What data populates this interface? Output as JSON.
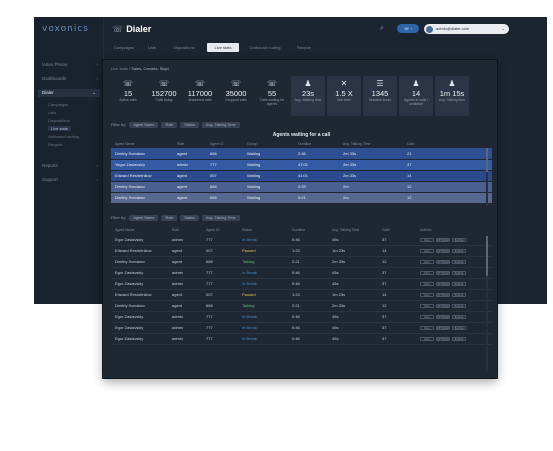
{
  "brand": "voxonics",
  "sidebar": {
    "items": [
      {
        "label": "Votes Phone",
        "arrow": "›"
      },
      {
        "label": "Dashboards",
        "arrow": "›"
      },
      {
        "label": "Dialer",
        "arrow": "⌄"
      }
    ],
    "sub_items": [
      "Campaigns",
      "Lists",
      "Dispositions",
      "Live stats",
      "Outbound routing",
      "Recycle"
    ],
    "bottom_items": [
      {
        "label": "Reports",
        "arrow": "›"
      },
      {
        "label": "Support",
        "arrow": "›"
      }
    ]
  },
  "header": {
    "title": "Dialer",
    "notif_label": "☏ ",
    "account_label": "admin@dialer.com"
  },
  "tabs": [
    "Campaigns",
    "Lists",
    "Dispositions",
    "Live stats",
    "Outbound routing",
    "Recycle"
  ],
  "breadcrumb": {
    "prefix": "Live stats /",
    "current": "Sales, Canada, Skyd"
  },
  "stats": [
    {
      "icon": "☏",
      "value": "15",
      "label": "Active calls"
    },
    {
      "icon": "☏",
      "value": "152700",
      "label": "Calls today"
    },
    {
      "icon": "☏",
      "value": "117000",
      "label": "Answered calls"
    },
    {
      "icon": "☏",
      "value": "35000",
      "label": "Dropped calls"
    },
    {
      "icon": "☏",
      "value": "55",
      "label": "Calls waiting for agents"
    },
    {
      "icon": "♟",
      "value": "23s",
      "label": "Avg. Waiting time"
    },
    {
      "icon": "✕",
      "value": "1.5 X",
      "label": "Dial level"
    },
    {
      "icon": "☰",
      "value": "1345",
      "label": "Dialable leads"
    },
    {
      "icon": "♟",
      "value": "14",
      "label": "Agents in calls / available"
    },
    {
      "icon": "♟",
      "value": "1m 15s",
      "label": "Avg. Talking time"
    }
  ],
  "filter1": {
    "label": "Filter by:",
    "chips": [
      "Agent Name",
      "Role",
      "Status",
      "Avg. Talking Time"
    ]
  },
  "waiting": {
    "title": "Agents waiting for a call",
    "headers": [
      "Agent Name",
      "Role",
      "Agent ID",
      "Group",
      "Duration",
      "Avg. Talking Time",
      "Calls"
    ],
    "rows": [
      [
        "Dmitriy Svedalov",
        "agent",
        "666",
        "Waiting",
        "2:46",
        "2m 33s",
        "21"
      ],
      [
        "Yegor Zaslavskiy",
        "admin",
        "777",
        "Waiting",
        "47:01",
        "2m 33s",
        "37"
      ],
      [
        "Edward Reshetnikov",
        "agent",
        "007",
        "Waiting",
        "41:01",
        "2m 33s",
        "14"
      ],
      [
        "Dmitriy Svedalov",
        "agent",
        "666",
        "Waiting",
        "0:33",
        "2m",
        "12"
      ],
      [
        "Dmitriy Svedalov",
        "agent",
        "666",
        "Waiting",
        "0:21",
        "2m",
        "12"
      ]
    ]
  },
  "filter2": {
    "label": "Filter by:",
    "chips": [
      "Agent Name",
      "Role",
      "Status",
      "Avg. Talking Time"
    ]
  },
  "agents": {
    "headers": [
      "Agent Name",
      "Role",
      "Agent ID",
      "Status",
      "Duration",
      "Avg. Talking Time",
      "Calls",
      "Actions"
    ],
    "actions": [
      "CALL",
      "WHISPER",
      "BARGE"
    ],
    "rows": [
      [
        "Egor Zaslavskiy",
        "admin",
        "777",
        "In Break",
        "0:46",
        "45s",
        "37",
        "break"
      ],
      [
        "Edward Reshetnikov",
        "agent",
        "007",
        "Paused",
        "1:23",
        "1m 23s",
        "14",
        "paused"
      ],
      [
        "Dmitriy Svedalov",
        "agent",
        "666",
        "Talking",
        "2:21",
        "2m 33s",
        "12",
        "talking"
      ],
      [
        "Egor Zaslavskiy",
        "admin",
        "777",
        "In Break",
        "0:46",
        "45s",
        "37",
        "break"
      ],
      [
        "Egor Zaslavskiy",
        "admin",
        "777",
        "In Break",
        "0:46",
        "45s",
        "37",
        "break"
      ],
      [
        "Edward Reshetnikov",
        "agent",
        "007",
        "Paused",
        "1:23",
        "1m 23s",
        "14",
        "paused"
      ],
      [
        "Dmitriy Svedalov",
        "agent",
        "666",
        "Talking",
        "2:21",
        "2m 33s",
        "12",
        "talking"
      ],
      [
        "Egor Zaslavskiy",
        "admin",
        "777",
        "In Break",
        "0:46",
        "45s",
        "37",
        "break"
      ],
      [
        "Egor Zaslavskiy",
        "admin",
        "777",
        "In Break",
        "0:46",
        "45s",
        "37",
        "break"
      ],
      [
        "Egor Zaslavskiy",
        "admin",
        "777",
        "In Break",
        "0:46",
        "45s",
        "37",
        "break"
      ]
    ]
  }
}
